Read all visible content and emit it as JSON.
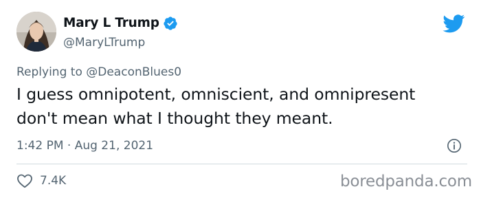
{
  "author": {
    "display_name": "Mary L Trump",
    "handle": "@MaryLTrump",
    "verified": true
  },
  "reply": {
    "prefix": "Replying to ",
    "mention": "@DeaconBlues0"
  },
  "tweet": {
    "line1": "I guess omnipotent, omniscient, and omnipresent",
    "line2": "don't mean what I thought they meant.",
    "timestamp": "1:42 PM · Aug 21, 2021"
  },
  "engagement": {
    "likes": "7.4K"
  },
  "watermark": "boredpanda.com",
  "icons": {
    "verified": "verified-badge-icon",
    "logo": "twitter-bird-icon",
    "info": "info-icon",
    "like": "heart-icon"
  },
  "colors": {
    "twitter_blue": "#1d9bf0",
    "text_primary": "#0f1419",
    "text_secondary": "#536471",
    "divider": "#cfd9de",
    "watermark": "#8a8f96"
  }
}
